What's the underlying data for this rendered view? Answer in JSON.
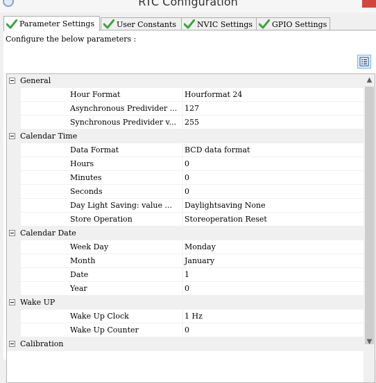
{
  "window": {
    "title": "RTC Configuration"
  },
  "tabs": [
    {
      "label": "Parameter Settings",
      "icon": "green-check-icon",
      "active": true
    },
    {
      "label": "User Constants",
      "icon": "green-check-icon",
      "active": false
    },
    {
      "label": "NVIC Settings",
      "icon": "green-check-icon",
      "active": false
    },
    {
      "label": "GPIO Settings",
      "icon": "green-check-icon",
      "active": false
    }
  ],
  "panel": {
    "instruction": "Configure the below parameters :",
    "view_button_icon": "categorized-view-icon"
  },
  "groups": [
    {
      "name": "General",
      "params": [
        {
          "name": "Hour Format",
          "value": "Hourformat 24"
        },
        {
          "name": "Asynchronous Predivider ...",
          "value": "127"
        },
        {
          "name": "Synchronous Predivider v...",
          "value": "255"
        }
      ]
    },
    {
      "name": "Calendar Time",
      "params": [
        {
          "name": "Data Format",
          "value": "BCD data format"
        },
        {
          "name": "Hours",
          "value": "0"
        },
        {
          "name": "Minutes",
          "value": "0"
        },
        {
          "name": "Seconds",
          "value": "0"
        },
        {
          "name": "Day Light Saving: value ...",
          "value": "Daylightsaving None"
        },
        {
          "name": "Store Operation",
          "value": "Storeoperation Reset"
        }
      ]
    },
    {
      "name": "Calendar Date",
      "params": [
        {
          "name": "Week Day",
          "value": "Monday"
        },
        {
          "name": "Month",
          "value": "January"
        },
        {
          "name": "Date",
          "value": "1"
        },
        {
          "name": "Year",
          "value": "0"
        }
      ]
    },
    {
      "name": "Wake UP",
      "params": [
        {
          "name": "Wake Up Clock",
          "value": "1 Hz"
        },
        {
          "name": "Wake Up Counter",
          "value": "0"
        }
      ]
    },
    {
      "name": "Calibration",
      "params": []
    }
  ],
  "colors": {
    "check": "#3aa53a",
    "category_bg": "#f0f0f0",
    "scroll_thumb": "#cdcdcd"
  }
}
